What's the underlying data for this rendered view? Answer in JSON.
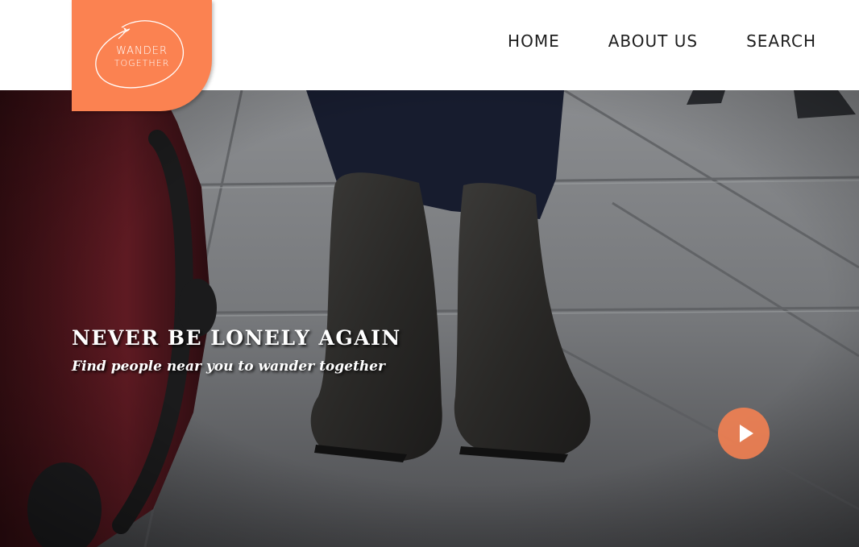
{
  "brand": {
    "line1": "WANDER",
    "line2": "TOGETHER",
    "color": "#fb8251"
  },
  "nav": {
    "items": [
      {
        "label": "HOME"
      },
      {
        "label": "ABOUT US"
      },
      {
        "label": "SEARCH"
      }
    ]
  },
  "hero": {
    "title": "NEVER BE LONELY AGAIN",
    "subtitle": "Find people near you to wander together",
    "play_icon": "play-icon",
    "image": "photo-boots-suitcase"
  }
}
